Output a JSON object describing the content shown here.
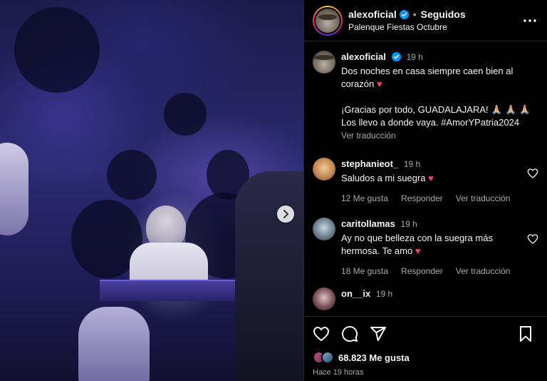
{
  "post": {
    "username": "alexoficial",
    "follow_status": "Seguidos",
    "location": "Palenque Fiestas Octubre",
    "media_alt": "Video en concierto"
  },
  "caption": {
    "username": "alexoficial",
    "time": "19 h",
    "line1": "Dos noches en casa siempre caen bien al corazón",
    "line1_emoji": "♥",
    "line2": "¡Gracias por todo, GUADALAJARA!",
    "line2_emoji": "🙏🏼 🙏🏼 🙏🏼",
    "line3": "Los llevo a donde vaya. #AmorYPatria2024",
    "see_translation": "Ver traducción"
  },
  "comments": [
    {
      "username": "stephanieot_",
      "time": "19 h",
      "text": "Saludos a mi suegra",
      "emoji": "♥",
      "likes": "12 Me gusta",
      "reply": "Responder",
      "translate": "Ver traducción"
    },
    {
      "username": "caritollamas",
      "time": "19 h",
      "text": "Ay no que belleza con la suegra más hermosa. Te amo",
      "emoji": "♥",
      "likes": "18 Me gusta",
      "reply": "Responder",
      "translate": "Ver traducción"
    },
    {
      "username": "on__ix",
      "time": "19 h"
    }
  ],
  "footer": {
    "likes_count": "68.823",
    "likes_label": "Me gusta",
    "posted_ago": "Hace 19 horas"
  },
  "colors": {
    "heart": "#ff3e6c",
    "verified": "#0095f6",
    "secondary_text": "#a8a8a8"
  },
  "icons": [
    "verified-badge-icon",
    "more-options-icon",
    "heart-icon",
    "comment-icon",
    "share-icon",
    "bookmark-icon",
    "next-arrow-icon"
  ]
}
